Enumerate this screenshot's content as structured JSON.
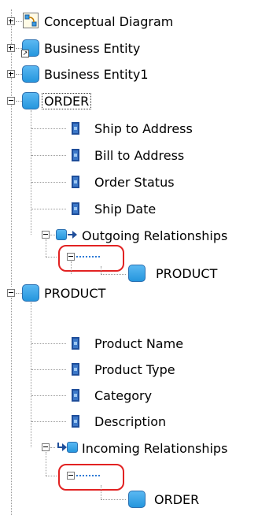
{
  "tree": {
    "items": [
      {
        "label": "Conceptual Diagram",
        "icon": "conceptual-diagram-icon",
        "expander": "plus"
      },
      {
        "label": "Business Entity",
        "icon": "business-entity-shortcut-icon",
        "expander": "plus"
      },
      {
        "label": "Business Entity1",
        "icon": "business-entity-icon",
        "expander": "plus"
      },
      {
        "label": "ORDER",
        "icon": "business-entity-icon",
        "expander": "minus",
        "selected": true,
        "children": [
          {
            "label": "Ship to Address",
            "icon": "attribute-icon"
          },
          {
            "label": "Bill to Address",
            "icon": "attribute-icon"
          },
          {
            "label": "Order Status",
            "icon": "attribute-icon"
          },
          {
            "label": "Ship Date",
            "icon": "attribute-icon"
          },
          {
            "label": "Outgoing Relationships",
            "icon": "outgoing-relationship-icon",
            "expander": "minus",
            "children": [
              {
                "label": "",
                "icon": "relationship-dots-icon",
                "expander": "minus",
                "children": [
                  {
                    "label": "PRODUCT",
                    "icon": "business-entity-icon"
                  }
                ]
              }
            ]
          }
        ]
      },
      {
        "label": "PRODUCT",
        "icon": "business-entity-icon",
        "expander": "minus",
        "children": [
          {
            "label": "Product Name",
            "icon": "attribute-icon"
          },
          {
            "label": "Product Type",
            "icon": "attribute-icon"
          },
          {
            "label": "Category",
            "icon": "attribute-icon"
          },
          {
            "label": "Description",
            "icon": "attribute-icon"
          },
          {
            "label": "Incoming Relationships",
            "icon": "incoming-relationship-icon",
            "expander": "minus",
            "children": [
              {
                "label": "",
                "icon": "relationship-dots-icon",
                "expander": "minus",
                "children": [
                  {
                    "label": "ORDER",
                    "icon": "business-entity-icon"
                  }
                ]
              }
            ]
          }
        ]
      }
    ]
  },
  "colors": {
    "entity": "#2596dd",
    "attribute": "#3c78c8",
    "highlight": "#e22222",
    "relationship": "#2d7ad6"
  }
}
